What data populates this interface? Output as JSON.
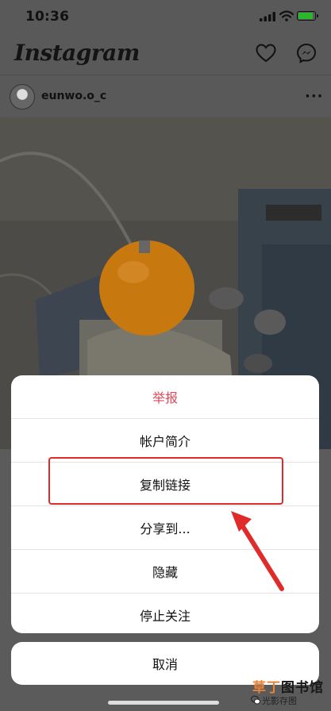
{
  "status_bar": {
    "time": "10:36"
  },
  "app": {
    "title": "Instagram"
  },
  "post": {
    "username": "eunwo.o_c",
    "more": "···"
  },
  "action_sheet": {
    "items": [
      {
        "label": "举报",
        "style": "destructive"
      },
      {
        "label": "帐户简介"
      },
      {
        "label": "复制链接"
      },
      {
        "label": "分享到..."
      },
      {
        "label": "隐藏"
      },
      {
        "label": "停止关注"
      }
    ],
    "cancel": "取消"
  },
  "watermark": {
    "main_prefix": "草丁",
    "main_suffix": "图书馆",
    "sub": "光影存图"
  },
  "colors": {
    "destructive": "#e0475b",
    "annotation_red": "#e02b2b",
    "battery_green": "#2bb72b",
    "watermark_orange": "#e8823a"
  },
  "icons": [
    "signal-icon",
    "wifi-icon",
    "battery-icon",
    "heart-icon",
    "messenger-icon",
    "more-icon",
    "wechat-logo-icon"
  ]
}
